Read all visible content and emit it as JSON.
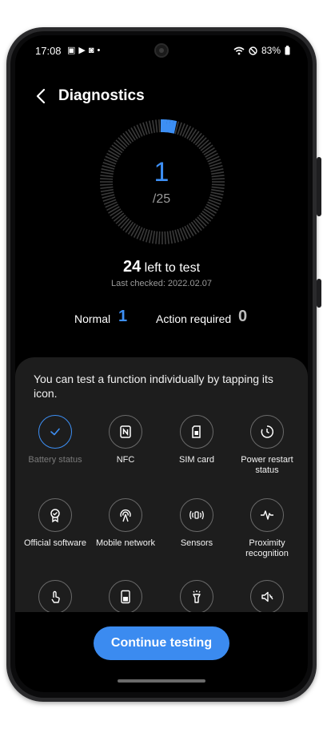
{
  "status_bar": {
    "time": "17:08",
    "battery": "83%",
    "left_icons": [
      "gallery-icon",
      "play-icon",
      "bag-icon",
      "dot-icon"
    ],
    "right_icons": [
      "wifi-icon",
      "no-disturb-icon",
      "battery-icon"
    ]
  },
  "header": {
    "title": "Diagnostics"
  },
  "progress": {
    "count": "1",
    "total": "/25",
    "fraction": 0.04
  },
  "left_to_test": {
    "number": "24",
    "text": "left to test"
  },
  "last_checked": "Last checked: 2022.02.07",
  "summary": {
    "normal_label": "Normal",
    "normal_value": "1",
    "action_label": "Action required",
    "action_value": "0"
  },
  "panel": {
    "note": "You can test a function individually by tapping its icon.",
    "items": [
      {
        "label": "Battery status",
        "icon": "check-icon"
      },
      {
        "label": "NFC",
        "icon": "nfc-icon"
      },
      {
        "label": "SIM card",
        "icon": "sim-card-icon"
      },
      {
        "label": "Power restart status",
        "icon": "power-restart-icon"
      },
      {
        "label": "Official software",
        "icon": "badge-icon"
      },
      {
        "label": "Mobile network",
        "icon": "antenna-icon"
      },
      {
        "label": "Sensors",
        "icon": "sensors-icon"
      },
      {
        "label": "Proximity recognition",
        "icon": "proximity-icon"
      },
      {
        "label": "",
        "icon": "touch-icon"
      },
      {
        "label": "",
        "icon": "screen-icon"
      },
      {
        "label": "",
        "icon": "flashlight-icon"
      },
      {
        "label": "",
        "icon": "speaker-mute-icon"
      }
    ]
  },
  "continue_button": "Continue testing",
  "colors": {
    "accent": "#3d8ff4",
    "background": "#000000",
    "panel": "#1d1d1d"
  }
}
